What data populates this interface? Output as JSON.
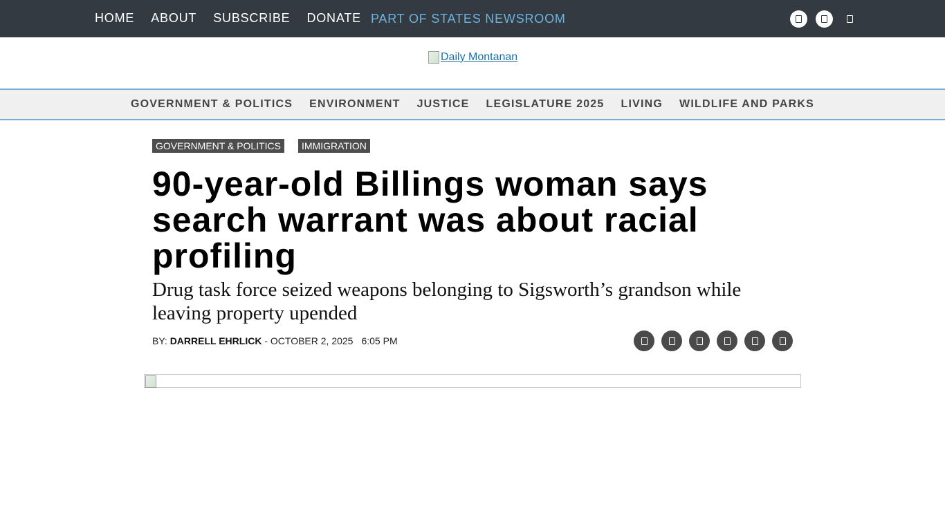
{
  "top_nav": {
    "items": [
      "HOME",
      "ABOUT",
      "SUBSCRIBE",
      "DONATE"
    ],
    "states_newsroom": "PART OF STATES NEWSROOM",
    "icons": [
      "social-icon",
      "social-icon",
      "search-icon"
    ]
  },
  "logo": {
    "alt": "Daily Montanan"
  },
  "section_nav": {
    "items": [
      "GOVERNMENT & POLITICS",
      "ENVIRONMENT",
      "JUSTICE",
      "LEGISLATURE 2025",
      "LIVING",
      "WILDLIFE AND PARKS"
    ]
  },
  "article": {
    "tags": [
      "GOVERNMENT & POLITICS",
      "IMMIGRATION"
    ],
    "headline": "90-year-old Billings woman says search warrant was about racial profiling",
    "subhead": "Drug task force seized weapons belonging to Sigsworth’s grandson while leaving property upended",
    "byline_prefix": "BY: ",
    "author": "DARRELL EHRLICK",
    "date_sep": " - ",
    "date": "OCTOBER 2, 2025",
    "time": "6:05 PM",
    "share_icons": [
      "share-icon",
      "share-icon",
      "share-icon",
      "share-icon",
      "share-icon",
      "share-icon"
    ]
  },
  "colors": {
    "topbar_bg": "#333a41",
    "accent_blue": "#6fb3dc",
    "nav_border": "#77aed3",
    "tag_bg": "#4d4d4d"
  }
}
